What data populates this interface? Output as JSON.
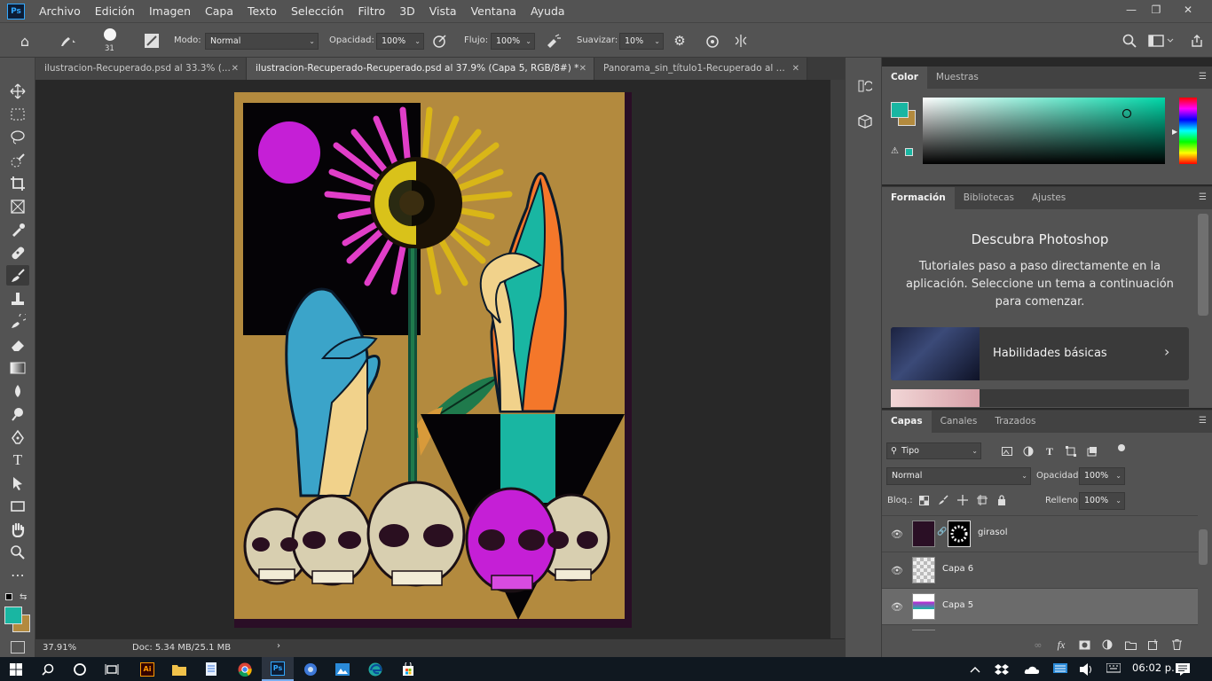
{
  "menu": {
    "items": [
      "Archivo",
      "Edición",
      "Imagen",
      "Capa",
      "Texto",
      "Selección",
      "Filtro",
      "3D",
      "Vista",
      "Ventana",
      "Ayuda"
    ]
  },
  "options": {
    "brush_size": "31",
    "mode_label": "Modo:",
    "mode_value": "Normal",
    "opacity_label": "Opacidad:",
    "opacity_value": "100%",
    "flow_label": "Flujo:",
    "flow_value": "100%",
    "smooth_label": "Suavizar:",
    "smooth_value": "10%"
  },
  "tabs": [
    {
      "label": "ilustracion-Recuperado.psd al 33.3% (...",
      "active": false
    },
    {
      "label": "ilustracion-Recuperado-Recuperado.psd al 37.9% (Capa 5, RGB/8#) *",
      "active": true
    },
    {
      "label": "Panorama_sin_título1-Recuperado al ...",
      "active": false
    }
  ],
  "status": {
    "zoom": "37.91%",
    "doc": "Doc: 5.34 MB/25.1 MB"
  },
  "color_panel": {
    "tabs": [
      "Color",
      "Muestras"
    ],
    "foreground": "#19b6a2",
    "background": "#b38a3e"
  },
  "learn_panel": {
    "tabs": [
      "Formación",
      "Bibliotecas",
      "Ajustes"
    ],
    "title": "Descubra Photoshop",
    "description": "Tutoriales paso a paso directamente en la aplicación. Seleccione un tema a continuación para comenzar.",
    "card_label": "Habilidades básicas"
  },
  "layers_panel": {
    "tabs": [
      "Capas",
      "Canales",
      "Trazados"
    ],
    "filter_label": "Tipo",
    "blend_mode": "Normal",
    "opacity_label": "Opacidad:",
    "opacity_value": "100%",
    "lock_label": "Bloq.:",
    "fill_label": "Relleno:",
    "fill_value": "100%",
    "layers": [
      {
        "name": "girasol",
        "selected": false
      },
      {
        "name": "Capa 6",
        "selected": false
      },
      {
        "name": "Capa 5",
        "selected": true
      }
    ]
  },
  "taskbar": {
    "time": "06:02 p. m."
  },
  "icons": {
    "tools": [
      "move-icon",
      "marquee-icon",
      "lasso-icon",
      "quick-select-icon",
      "crop-icon",
      "frame-icon",
      "eyedropper-icon",
      "healing-icon",
      "brush-icon",
      "stamp-icon",
      "history-brush-icon",
      "eraser-icon",
      "gradient-icon",
      "blur-icon",
      "dodge-icon",
      "pen-icon",
      "type-icon",
      "path-select-icon",
      "rectangle-icon",
      "hand-icon",
      "zoom-icon",
      "more-icon"
    ]
  }
}
